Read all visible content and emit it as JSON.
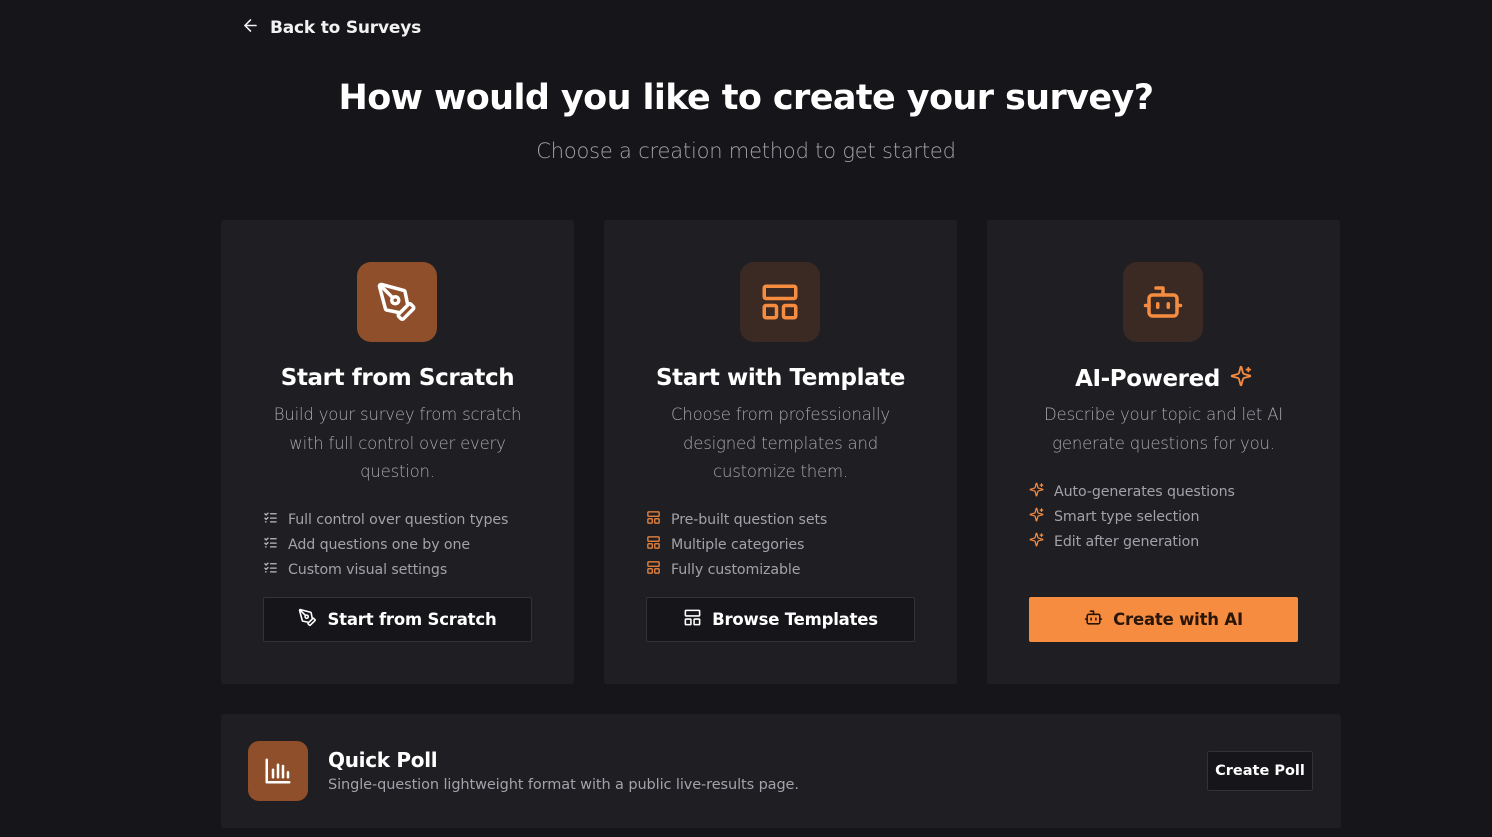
{
  "nav": {
    "back_label": "Back to Surveys"
  },
  "header": {
    "title": "How would you like to create your survey?",
    "subtitle": "Choose a creation method to get started"
  },
  "colors": {
    "accent": "#f68c40",
    "accent_dark": "#8f4f2b",
    "background": "#161519",
    "card": "#1f1e22"
  },
  "cards": [
    {
      "icon": "pen-tool-icon",
      "title": "Start from Scratch",
      "description": "Build your survey from scratch with full control over every question.",
      "features": [
        "Full control over question types",
        "Add questions one by one",
        "Custom visual settings"
      ],
      "feature_icon": "list-checks-icon",
      "button_label": "Start from Scratch"
    },
    {
      "icon": "layout-template-icon",
      "title": "Start with Template",
      "description": "Choose from professionally designed templates and customize them.",
      "features": [
        "Pre-built question sets",
        "Multiple categories",
        "Fully customizable"
      ],
      "feature_icon": "layout-template-icon",
      "button_label": "Browse Templates"
    },
    {
      "icon": "bot-icon",
      "title": "AI-Powered",
      "description": "Describe your topic and let AI generate questions for you.",
      "features": [
        "Auto-generates questions",
        "Smart type selection",
        "Edit after generation"
      ],
      "feature_icon": "sparkles-icon",
      "button_label": "Create with AI"
    }
  ],
  "quick_poll": {
    "icon": "bar-chart-icon",
    "title": "Quick Poll",
    "description": "Single-question lightweight format with a public live-results page.",
    "button_label": "Create Poll"
  }
}
